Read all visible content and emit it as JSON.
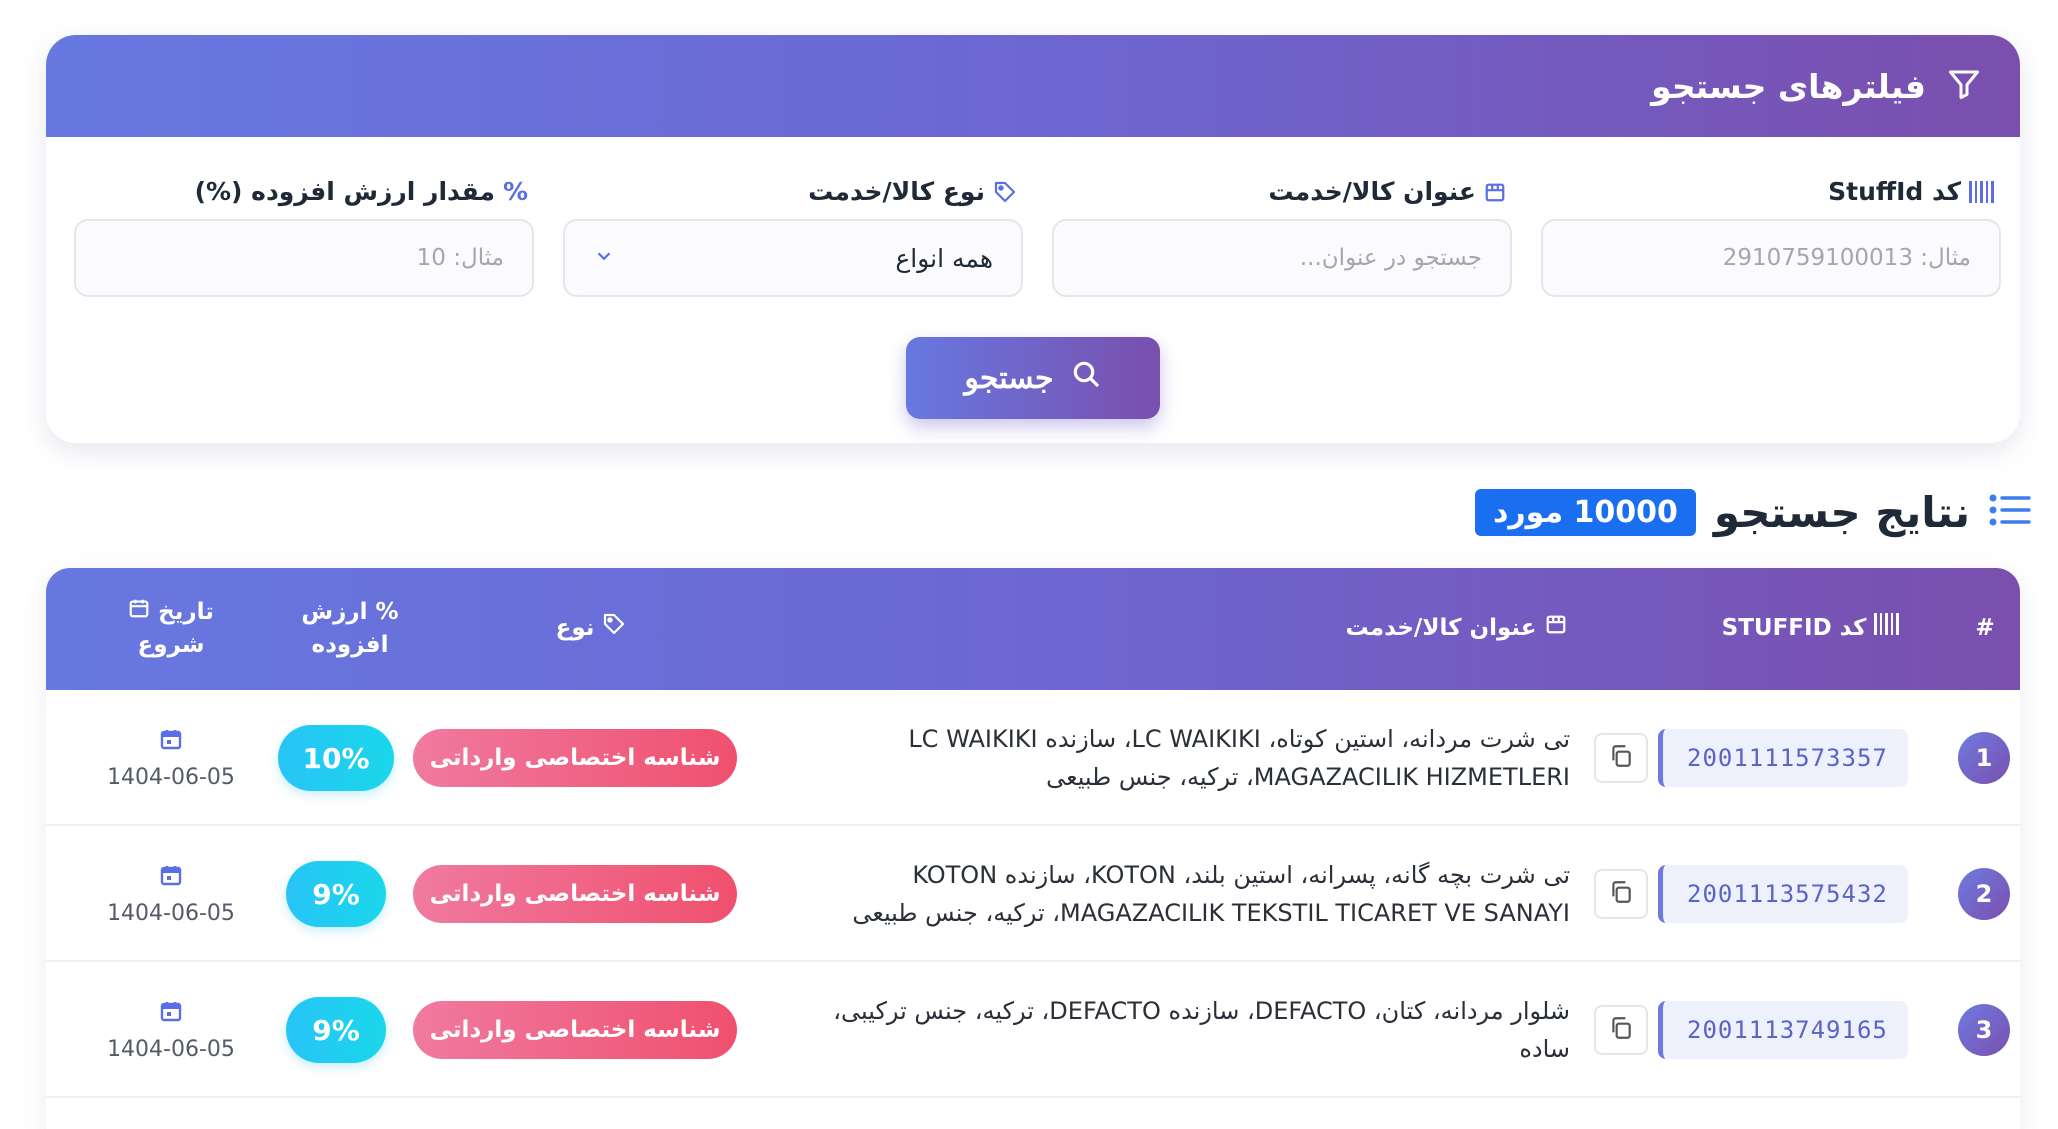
{
  "filters": {
    "title": "فیلترهای جستجو",
    "fields": {
      "stuffid": {
        "label": "کد StuffId",
        "placeholder": "مثال: 2910759100013"
      },
      "title": {
        "label": "عنوان کالا/خدمت",
        "placeholder": "جستجو در عنوان..."
      },
      "type": {
        "label": "نوع کالا/خدمت",
        "value": "همه انواع"
      },
      "vat": {
        "label": "مقدار ارزش افزوده (%)",
        "icon_text": "%",
        "placeholder": "مثال: 10"
      }
    },
    "search_button": "جستجو"
  },
  "results": {
    "title": "نتایج جستجو",
    "count_badge": "10000 مورد"
  },
  "table": {
    "headers": {
      "num": "#",
      "code": "کد STUFFID",
      "title": "عنوان کالا/خدمت",
      "type": "نوع",
      "vat_line1": "% ارزش",
      "vat_line2": "افزوده",
      "date_line1": "تاریخ",
      "date_line2": "شروع"
    },
    "rows": [
      {
        "num": "1",
        "code": "2001111573357",
        "title": "تی شرت مردانه، استین کوتاه، LC WAIKIKI، سازنده LC WAIKIKI MAGAZACILIK HIZMETLERI، ترکیه، جنس طبیعی",
        "type": "شناسه اختصاصی وارداتی",
        "vat": "10%",
        "date": "1404-06-05"
      },
      {
        "num": "2",
        "code": "2001113575432",
        "title": "تی شرت بچه گانه، پسرانه، استین بلند، KOTON، سازنده KOTON MAGAZACILIK TEKSTIL TICARET VE SANAYI، ترکیه، جنس طبیعی",
        "type": "شناسه اختصاصی وارداتی",
        "vat": "9%",
        "date": "1404-06-05"
      },
      {
        "num": "3",
        "code": "2001113749165",
        "title": "شلوار مردانه، کتان، DEFACTO، سازنده DEFACTO، ترکیه، جنس ترکیبی، ساده",
        "type": "شناسه اختصاصی وارداتی",
        "vat": "9%",
        "date": "1404-06-05"
      }
    ]
  },
  "colors": {
    "header_gradient_start": "#6778e0",
    "header_gradient_end": "#7a4fae",
    "count_badge": "#1a6ff0",
    "type_pill": "#f0506e",
    "vat_pill": "#28c4f7"
  }
}
